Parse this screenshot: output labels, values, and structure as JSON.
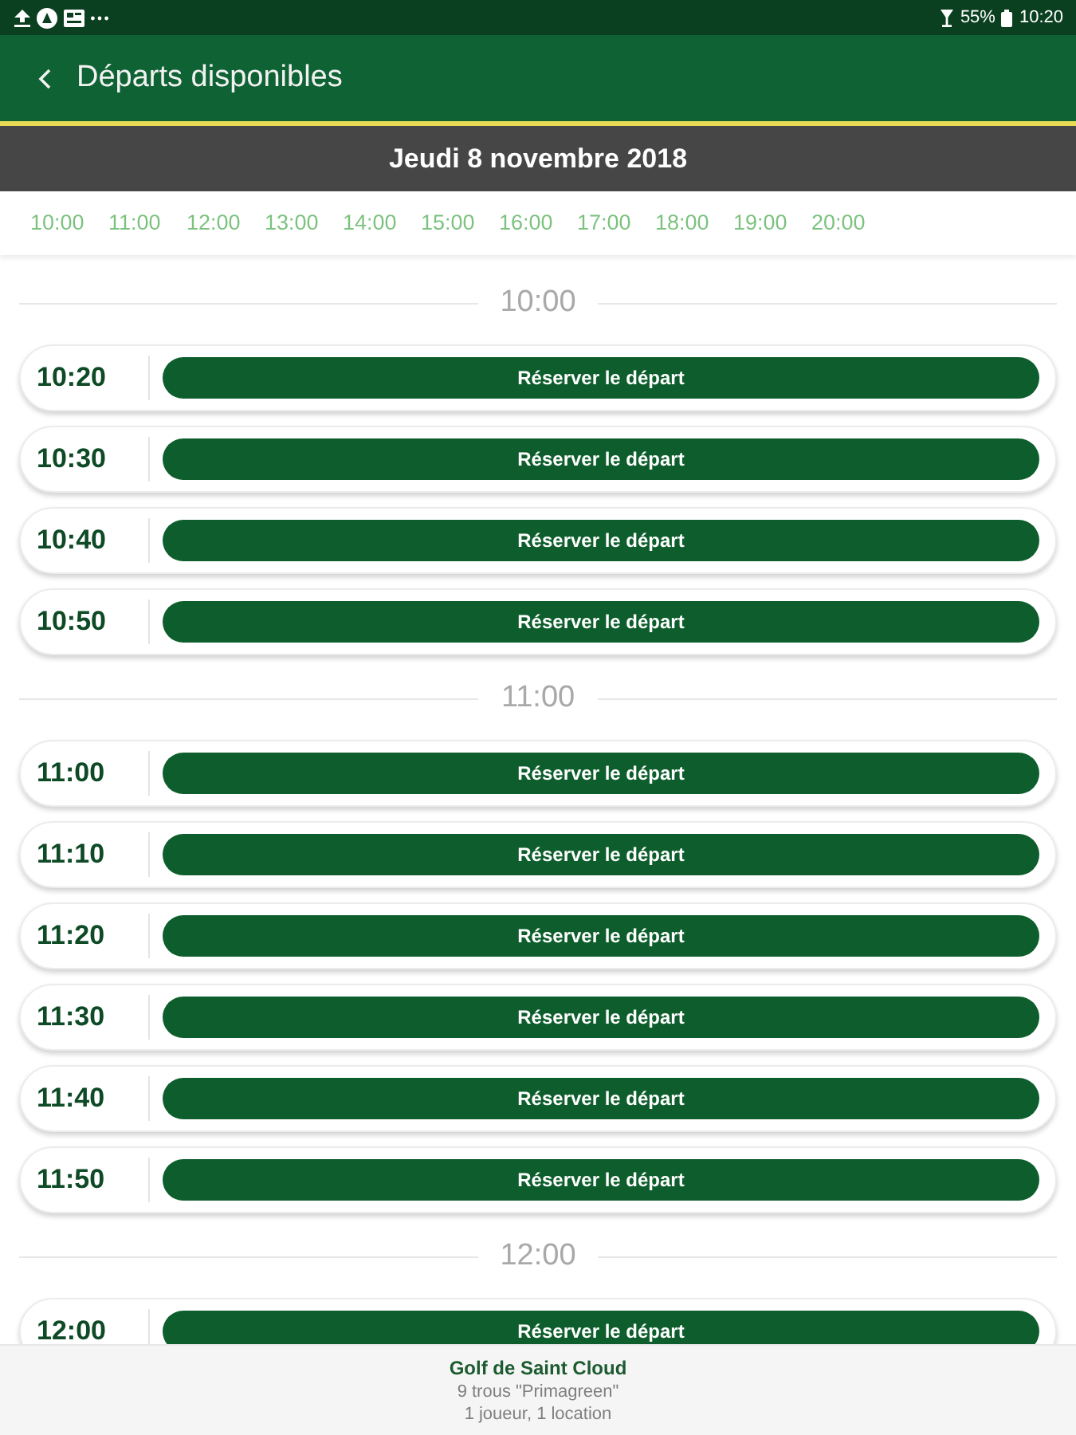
{
  "status_bar": {
    "battery": "55%",
    "time": "10:20"
  },
  "app_bar": {
    "title": "Départs disponibles"
  },
  "date_bar": {
    "date": "Jeudi 8 novembre 2018"
  },
  "hour_links": [
    "10:00",
    "11:00",
    "12:00",
    "13:00",
    "14:00",
    "15:00",
    "16:00",
    "17:00",
    "18:00",
    "19:00",
    "20:00"
  ],
  "sections": [
    {
      "hour": "10:00",
      "slots": [
        {
          "time": "10:20",
          "button": "Réserver le départ"
        },
        {
          "time": "10:30",
          "button": "Réserver le départ"
        },
        {
          "time": "10:40",
          "button": "Réserver le départ"
        },
        {
          "time": "10:50",
          "button": "Réserver le départ"
        }
      ]
    },
    {
      "hour": "11:00",
      "slots": [
        {
          "time": "11:00",
          "button": "Réserver le départ"
        },
        {
          "time": "11:10",
          "button": "Réserver le départ"
        },
        {
          "time": "11:20",
          "button": "Réserver le départ"
        },
        {
          "time": "11:30",
          "button": "Réserver le départ"
        },
        {
          "time": "11:40",
          "button": "Réserver le départ"
        },
        {
          "time": "11:50",
          "button": "Réserver le départ"
        }
      ]
    },
    {
      "hour": "12:00",
      "slots": [
        {
          "time": "12:00",
          "button": "Réserver le départ"
        }
      ]
    }
  ],
  "footer": {
    "course": "Golf de Saint Cloud",
    "layout": "9 trous \"Primagreen\"",
    "details": "1 joueur, 1 location"
  }
}
